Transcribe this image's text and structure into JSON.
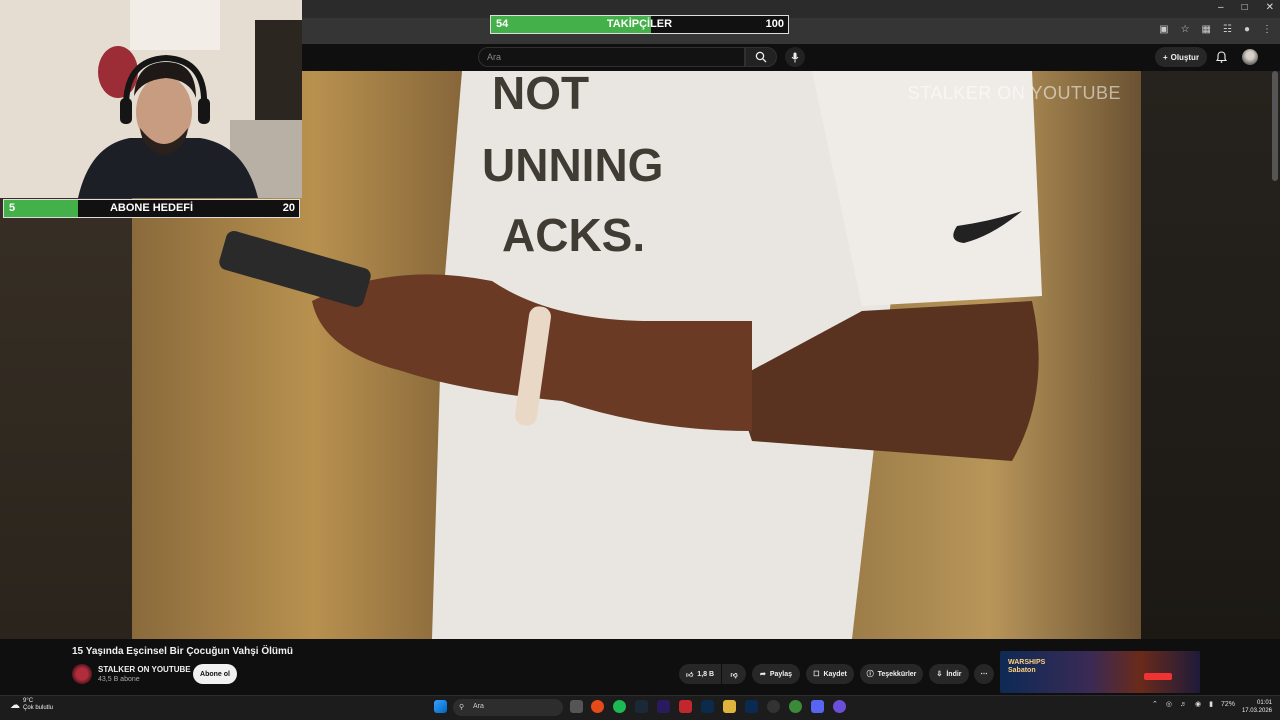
{
  "overlays": {
    "followers": {
      "label": "TAKİPÇİLER",
      "current": "54",
      "goal": "100",
      "progress": 0.54
    },
    "subscribers": {
      "label": "ABONE HEDEFİ",
      "current": "5",
      "goal": "20",
      "progress": 0.25
    }
  },
  "header": {
    "search_placeholder": "Ara",
    "create_label": "Oluştur"
  },
  "video": {
    "watermark": "STALKER ON YOUTUBE",
    "title": "15 Yaşında Eşcinsel Bir Çocuğun Vahşi Ölümü"
  },
  "channel": {
    "name": "STALKER ON YOUTUBE",
    "subscribers": "43,5 B abone",
    "subscribe_label": "Abone ol"
  },
  "actions": {
    "likes": "1,8 B",
    "share": "Paylaş",
    "save": "Kaydet",
    "thanks": "Teşekkürler",
    "download": "İndir"
  },
  "taskbar": {
    "weather_temp": "9°C",
    "weather_desc": "Çok bulutlu",
    "search_placeholder": "Ara",
    "battery": "72%",
    "time": "01:01",
    "date": "17.03.2026"
  },
  "colors": {
    "progress_green": "#43b049",
    "background": "#0f0f0f"
  }
}
